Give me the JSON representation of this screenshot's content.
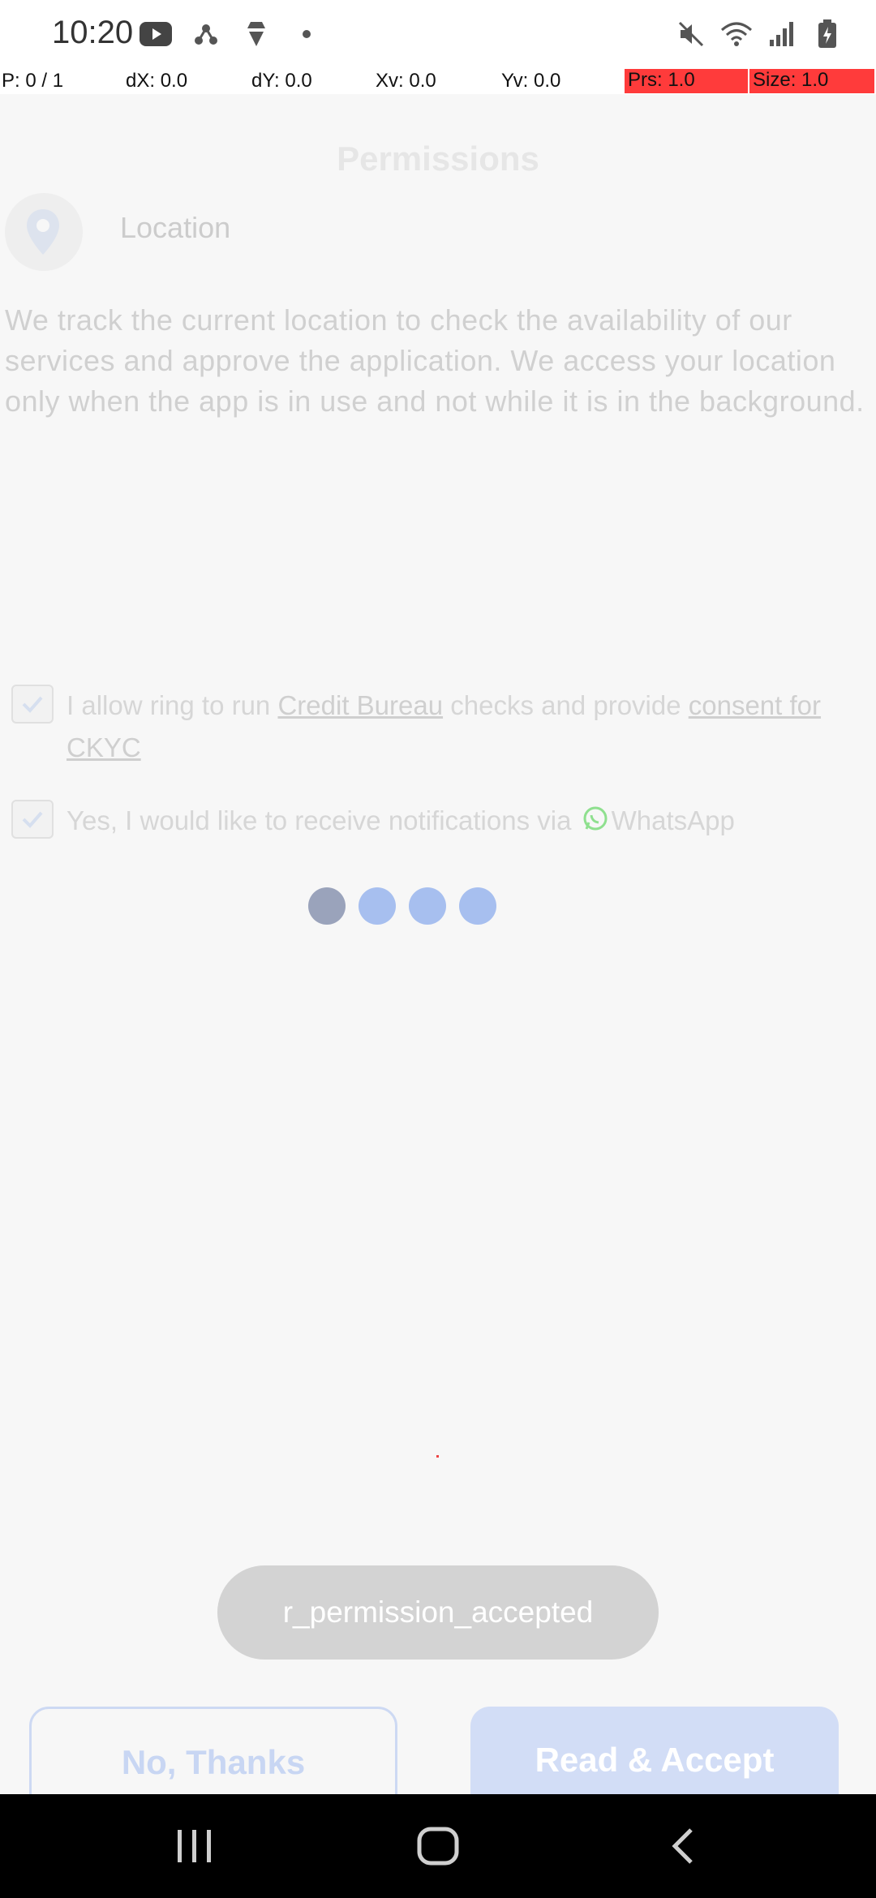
{
  "status_bar": {
    "time": "10:20",
    "left_icons": [
      "youtube-icon",
      "share-hub-icon",
      "incognito-icon",
      "dot-icon"
    ],
    "right_icons": [
      "mute-icon",
      "wifi-icon",
      "signal-icon",
      "battery-icon"
    ]
  },
  "debug": {
    "pointer": "P: 0 / 1",
    "dx": "dX: 0.0",
    "dy": "dY: 0.0",
    "xv": "Xv: 0.0",
    "yv": "Yv: 0.0",
    "prs": "Prs: 1.0",
    "size": "Size: 1.0"
  },
  "page": {
    "title": "Permissions",
    "location_label": "Location",
    "description": "We track the current location to check the availability of our services and approve the application. We access your location only when the app is in use and not while it is in the background.",
    "consent_1": {
      "prefix": "I allow ring to run ",
      "link1": "Credit Bureau",
      "middle": " checks and provide ",
      "link2": "consent for CKYC"
    },
    "consent_2": {
      "prefix": "Yes, I would like to receive notifications via ",
      "suffix": "WhatsApp"
    }
  },
  "toast": {
    "text": "r_permission_accepted"
  },
  "buttons": {
    "no_thanks": "No, Thanks",
    "read_accept": "Read & Accept"
  },
  "colors": {
    "accent": "#a7bfef",
    "whatsapp": "#6fd36f"
  }
}
